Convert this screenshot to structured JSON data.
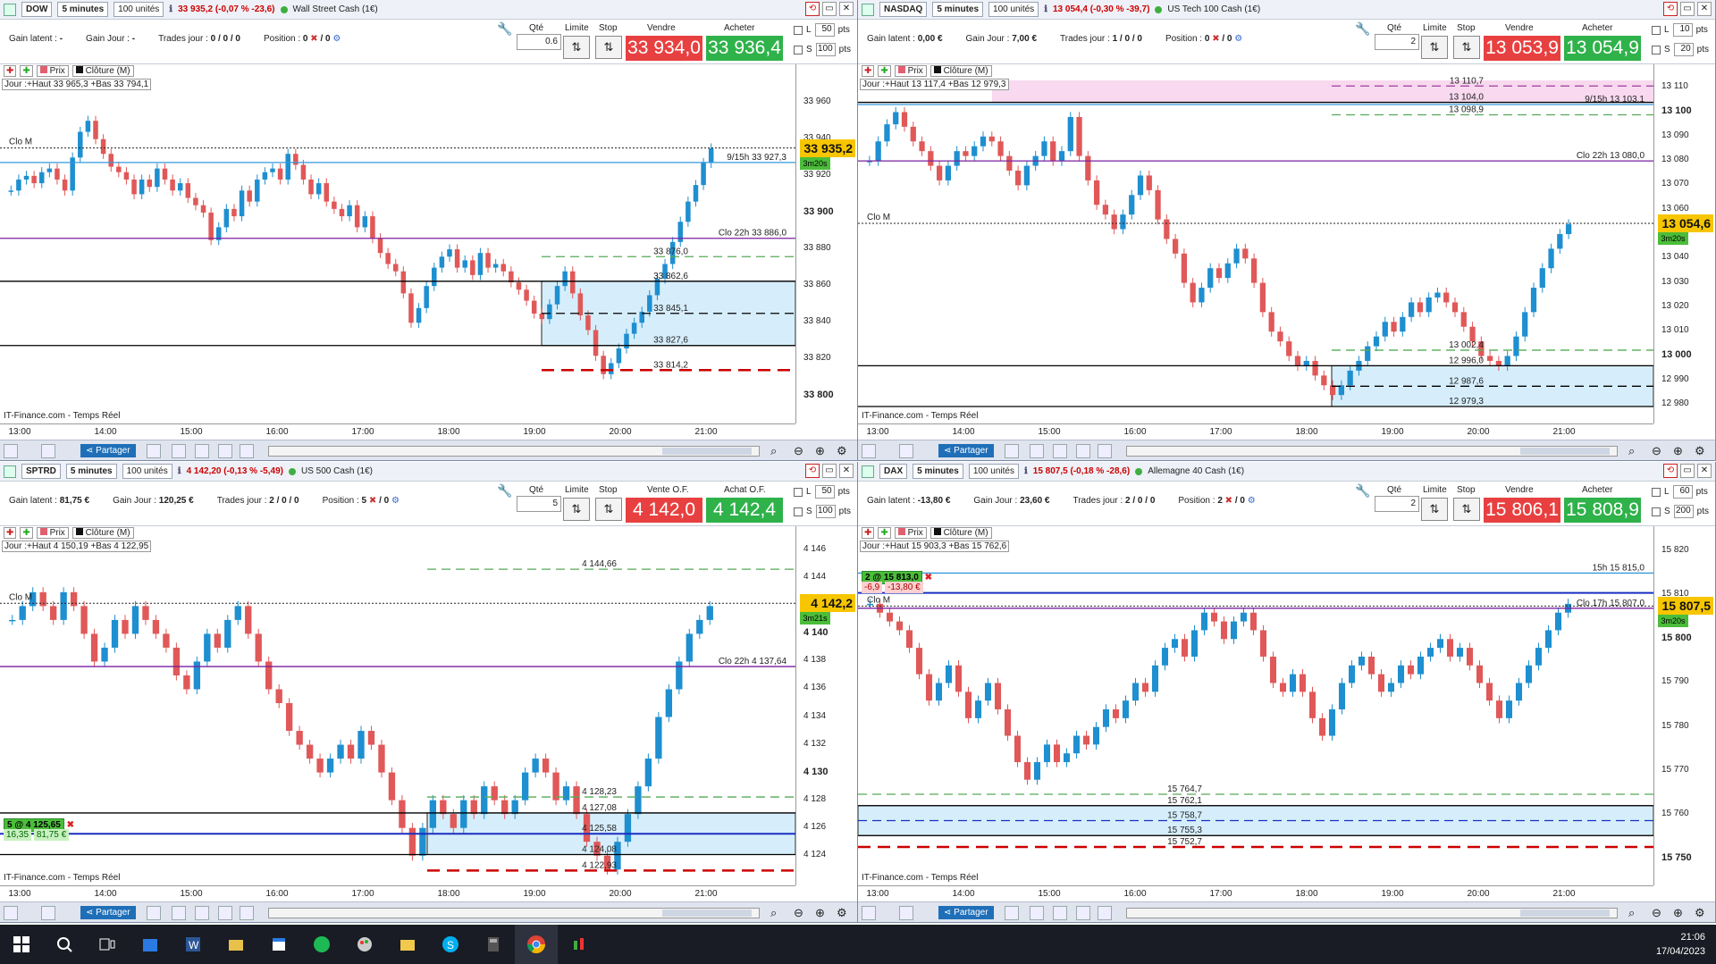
{
  "source": "IT-Finance.com - Temps Réel",
  "labels": {
    "qte": "Qté",
    "limite": "Limite",
    "stop": "Stop",
    "prix": "Prix",
    "cloture": "Clôture (M)",
    "partager": "Partager",
    "gain_latent": "Gain latent :",
    "gain_jour": "Gain Jour :",
    "trades_jour": "Trades jour :",
    "position": "Position :",
    "pts": "pts",
    "L": "L",
    "S": "S"
  },
  "x_axis": [
    "13:00",
    "14:00",
    "15:00",
    "16:00",
    "17:00",
    "18:00",
    "19:00",
    "20:00",
    "21:00"
  ],
  "taskbar": {
    "time": "21:06",
    "date": "17/04/2023",
    "apps": [
      "start-icon",
      "search-icon",
      "task-view-icon",
      "store-icon",
      "word-icon",
      "explorer-icon",
      "calendar-icon",
      "spotify-icon",
      "paint-icon",
      "folder-icon",
      "skype-icon",
      "calculator-icon",
      "chrome-icon",
      "prorealtime-icon"
    ]
  },
  "panels": [
    {
      "ticker": "DOW",
      "timeframe": "5 minutes",
      "units": "100 unités",
      "change": "33 935,2 (-0,07 % -23,6)",
      "instrument": "Wall Street Cash (1€)",
      "gain_latent": "-",
      "gain_jour": "-",
      "trades_jour": "0 / 0 / 0",
      "position": "0",
      "position_slash": "/ 0",
      "qty": "0.6",
      "sell_label": "Vendre",
      "buy_label": "Acheter",
      "sell": "33 934,0",
      "buy": "33 936,4",
      "L_val": "50",
      "S_val": "100",
      "day_info": "Jour :+Haut 33 965,3 +Bas 33 794,1",
      "clo_m": "Clo M",
      "price_tag": "33 935,2",
      "time_tag": "3m20s",
      "time_tag_side": "2",
      "ylabels": [
        "33 960",
        "33 940",
        "33 920",
        "33 900",
        "33 880",
        "33 860",
        "33 840",
        "33 820",
        "33 800"
      ],
      "ybold": [
        "33 900",
        "33 800"
      ],
      "ymin": 33790,
      "ymax": 33972,
      "last": 33935.2,
      "levels": [
        {
          "t": "9/15h 33 927,3",
          "v": 33927.3,
          "c": "#3399dd",
          "style": "solid"
        },
        {
          "t": "Clo 22h 33 886,0",
          "v": 33886.0,
          "c": "#7a1fa0",
          "style": "solid"
        },
        {
          "t": "33 876,0",
          "v": 33876,
          "c": "#5a5",
          "style": "dash"
        },
        {
          "t": "33 862,6",
          "v": 33862.6,
          "c": "#000",
          "style": "solid"
        },
        {
          "t": "33 845,1",
          "v": 33845.1,
          "c": "#000",
          "style": "dash"
        },
        {
          "t": "33 827,6",
          "v": 33827.6,
          "c": "#000",
          "style": "solid"
        },
        {
          "t": "33 814,2",
          "v": 33814.2,
          "c": "#c00",
          "style": "bigdash"
        }
      ],
      "zone": [
        33827.6,
        33862.6
      ],
      "candles": [
        33912,
        33918,
        33920,
        33916,
        33922,
        33924,
        33918,
        33912,
        33930,
        33944,
        33950,
        33940,
        33932,
        33925,
        33922,
        33918,
        33910,
        33918,
        33914,
        33924,
        33918,
        33912,
        33916,
        33908,
        33904,
        33900,
        33885,
        33892,
        33902,
        33898,
        33912,
        33906,
        33918,
        33922,
        33924,
        33918,
        33932,
        33926,
        33918,
        33910,
        33916,
        33906,
        33902,
        33898,
        33904,
        33892,
        33898,
        33886,
        33878,
        33872,
        33868,
        33856,
        33840,
        33848,
        33860,
        33870,
        33876,
        33880,
        33870,
        33874,
        33866,
        33878,
        33870,
        33872,
        33868,
        33862,
        33858,
        33852,
        33845,
        33842,
        33850,
        33860,
        33868,
        33856,
        33844,
        33836,
        33822,
        33812,
        33818,
        33826,
        33834,
        33840,
        33846,
        33855,
        33864,
        33872,
        33884,
        33895,
        33906,
        33915,
        33927,
        33935
      ]
    },
    {
      "ticker": "NASDAQ",
      "timeframe": "5 minutes",
      "units": "100 unités",
      "change": "13 054,4 (-0,30 % -39,7)",
      "instrument": "US Tech 100 Cash (1€)",
      "gain_latent": "0,00 €",
      "gain_jour": "7,00 €",
      "trades_jour": "1 / 0 / 0",
      "position": "0",
      "position_slash": "/ 0",
      "qty": "2",
      "sell_label": "Vendre",
      "buy_label": "Acheter",
      "sell": "13 053,9",
      "buy": "13 054,9",
      "L_val": "10",
      "S_val": "20",
      "day_info": "Jour :+Haut 13 117,4 +Bas 12 979,3",
      "clo_m": "Clo M",
      "price_tag": "13 054,6",
      "time_tag": "3m20s",
      "time_tag_side": "6",
      "ylabels": [
        "13 110",
        "13 100",
        "13 090",
        "13 080",
        "13 070",
        "13 060",
        "13 050",
        "13 040",
        "13 030",
        "13 020",
        "13 010",
        "13 000",
        "12 990",
        "12 980"
      ],
      "ybold": [
        "13 100",
        "13 000"
      ],
      "ymin": 12976,
      "ymax": 13113,
      "last": 13054.4,
      "levels": [
        {
          "t": "13 110,7",
          "v": 13110.7,
          "c": "#a03aa0",
          "style": "dash"
        },
        {
          "t": "13 104,0",
          "v": 13104.0,
          "c": "#000",
          "style": "solid"
        },
        {
          "t": "9/15h 13 103,1",
          "v": 13103.1,
          "c": "#3399dd",
          "style": "solid"
        },
        {
          "t": "13 098,9",
          "v": 13098.9,
          "c": "#5a5",
          "style": "dash"
        },
        {
          "t": "Clo 22h 13 080,0",
          "v": 13080.0,
          "c": "#7a1fa0",
          "style": "solid"
        },
        {
          "t": "13 002,4",
          "v": 13002.4,
          "c": "#5a5",
          "style": "dash"
        },
        {
          "t": "12 996,0",
          "v": 12996.0,
          "c": "#000",
          "style": "solid"
        },
        {
          "t": "12 987,6",
          "v": 12987.6,
          "c": "#000",
          "style": "dash"
        },
        {
          "t": "12 979,3",
          "v": 12979.3,
          "c": "#000",
          "style": "solid"
        }
      ],
      "zone": [
        12979.3,
        12996.0
      ],
      "pinkzone": [
        13104.0,
        13113
      ],
      "candles": [
        13080,
        13088,
        13095,
        13100,
        13094,
        13088,
        13084,
        13078,
        13072,
        13078,
        13084,
        13082,
        13086,
        13090,
        13088,
        13082,
        13076,
        13070,
        13078,
        13082,
        13088,
        13080,
        13084,
        13098,
        13082,
        13072,
        13062,
        13058,
        13052,
        13058,
        13066,
        13074,
        13068,
        13056,
        13048,
        13042,
        13030,
        13022,
        13028,
        13036,
        13032,
        13038,
        13044,
        13040,
        13030,
        13018,
        13010,
        13006,
        13000,
        12996,
        12998,
        12992,
        12988,
        12984,
        12988,
        12994,
        12998,
        13004,
        13008,
        13014,
        13010,
        13016,
        13022,
        13018,
        13024,
        13026,
        13022,
        13018,
        13012,
        13006,
        13000,
        12998,
        12996,
        13000,
        13008,
        13018,
        13028,
        13036,
        13044,
        13050,
        13054
      ]
    },
    {
      "ticker": "SPTRD",
      "timeframe": "5 minutes",
      "units": "100 unités",
      "change": "4 142,20 (-0,13 % -5,49)",
      "instrument": "US 500 Cash (1€)",
      "gain_latent": "81,75 €",
      "gain_jour": "120,25 €",
      "trades_jour": "2 / 0 / 0",
      "position": "5",
      "position_slash": "/ 0",
      "qty": "5",
      "sell_label": "Vente O.F.",
      "buy_label": "Achat O.F.",
      "sell": "4 142,0",
      "buy": "4 142,4",
      "L_val": "50",
      "S_val": "100",
      "day_info": "Jour :+Haut 4 150,19 +Bas 4 122,95",
      "clo_m": "Clo M",
      "price_tag": "4 142,2",
      "time_tag": "3m21s",
      "time_tag_side": "0",
      "ylabels": [
        "4 146",
        "4 144",
        "4 142",
        "4 140",
        "4 138",
        "4 136",
        "4 134",
        "4 132",
        "4 130",
        "4 128",
        "4 126",
        "4 124"
      ],
      "ybold": [
        "4 140",
        "4 130"
      ],
      "ymin": 4122.5,
      "ymax": 4146.6,
      "last": 4142.2,
      "levels": [
        {
          "t": "4 144,66",
          "v": 4144.66,
          "c": "#5a5",
          "style": "dash"
        },
        {
          "t": "Clo 22h 4 137,64",
          "v": 4137.64,
          "c": "#7a1fa0",
          "style": "solid"
        },
        {
          "t": "4 128,23",
          "v": 4128.23,
          "c": "#5a5",
          "style": "dash"
        },
        {
          "t": "4 127,08",
          "v": 4127.08,
          "c": "#000",
          "style": "solid"
        },
        {
          "t": "4 125,58",
          "v": 4125.58,
          "c": "#1a2ec0",
          "style": "bold"
        },
        {
          "t": "4 124,08",
          "v": 4124.08,
          "c": "#000",
          "style": "solid"
        },
        {
          "t": "4 122,93",
          "v": 4122.93,
          "c": "#c00",
          "style": "bigdash"
        }
      ],
      "zone": [
        4124.08,
        4127.08
      ],
      "position_badge": "5 @ 4 125,65",
      "pnl_a": "16,35",
      "pnl_b": "81,75 €",
      "candles": [
        4141,
        4142,
        4143,
        4142,
        4141,
        4143,
        4142,
        4140,
        4138,
        4139,
        4141,
        4140,
        4142,
        4141,
        4140,
        4139,
        4137,
        4136,
        4138,
        4140,
        4139,
        4141,
        4142,
        4140,
        4138,
        4136,
        4135,
        4133,
        4132,
        4131,
        4130,
        4131,
        4132,
        4131,
        4133,
        4132,
        4130,
        4128,
        4126,
        4124,
        4126,
        4128,
        4127,
        4126,
        4128,
        4127,
        4129,
        4128,
        4127,
        4128,
        4130,
        4131,
        4130,
        4128,
        4129,
        4127,
        4125,
        4124,
        4123,
        4125,
        4127,
        4129,
        4131,
        4134,
        4136,
        4138,
        4140,
        4141,
        4142
      ]
    },
    {
      "ticker": "DAX",
      "timeframe": "5 minutes",
      "units": "100 unités",
      "change": "15 807,5 (-0,18 % -28,6)",
      "instrument": "Allemagne 40 Cash (1€)",
      "gain_latent": "-13,80 €",
      "gain_jour": "23,60 €",
      "trades_jour": "2 / 0 / 0",
      "position": "2",
      "position_slash": "/ 0",
      "qty": "2",
      "sell_label": "Vendre",
      "buy_label": "Acheter",
      "sell": "15 806,1",
      "buy": "15 808,9",
      "L_val": "60",
      "S_val": "200",
      "day_info": "Jour :+Haut 15 903,3 +Bas 15 762,6",
      "clo_m": "Clo M",
      "price_tag": "15 807,5",
      "time_tag": "3m20s",
      "time_tag_side": "5",
      "ylabels": [
        "15 820",
        "15 810",
        "15 800",
        "15 790",
        "15 780",
        "15 770",
        "15 760",
        "15 750"
      ],
      "ybold": [
        "15 800",
        "15 750"
      ],
      "ymin": 15746,
      "ymax": 15822,
      "last": 15807.5,
      "levels": [
        {
          "t": "15h 15 815,0",
          "v": 15815.0,
          "c": "#3399dd",
          "style": "solid"
        },
        {
          "t": "",
          "v": 15810.5,
          "c": "#1a2ec0",
          "style": "bold"
        },
        {
          "t": "Clo 17h 15 807,0",
          "v": 15807.0,
          "c": "#7a1fa0",
          "style": "solid"
        },
        {
          "t": "15 764,7",
          "v": 15764.7,
          "c": "#5a5",
          "style": "dash"
        },
        {
          "t": "15 762,1",
          "v": 15762.1,
          "c": "#000",
          "style": "solid"
        },
        {
          "t": "15 758,7",
          "v": 15758.7,
          "c": "#1a2ec0",
          "style": "dash"
        },
        {
          "t": "15 755,3",
          "v": 15755.3,
          "c": "#000",
          "style": "solid"
        },
        {
          "t": "15 752,7",
          "v": 15752.7,
          "c": "#c00",
          "style": "bigdash"
        }
      ],
      "zone": [
        15755.3,
        15762.1
      ],
      "position_badge": "2 @ 15 813,0",
      "pnl_a": "-6,9",
      "pnl_b": "-13,80 €",
      "candles": [
        15808,
        15806,
        15804,
        15802,
        15798,
        15792,
        15786,
        15790,
        15794,
        15788,
        15782,
        15786,
        15790,
        15784,
        15778,
        15772,
        15768,
        15772,
        15776,
        15772,
        15774,
        15778,
        15776,
        15780,
        15784,
        15782,
        15786,
        15790,
        15788,
        15794,
        15798,
        15800,
        15796,
        15802,
        15806,
        15804,
        15800,
        15804,
        15806,
        15802,
        15796,
        15790,
        15788,
        15792,
        15788,
        15782,
        15778,
        15784,
        15790,
        15794,
        15796,
        15792,
        15788,
        15790,
        15794,
        15792,
        15796,
        15798,
        15800,
        15796,
        15798,
        15794,
        15790,
        15786,
        15782,
        15786,
        15790,
        15794,
        15798,
        15802,
        15806,
        15808
      ]
    }
  ]
}
